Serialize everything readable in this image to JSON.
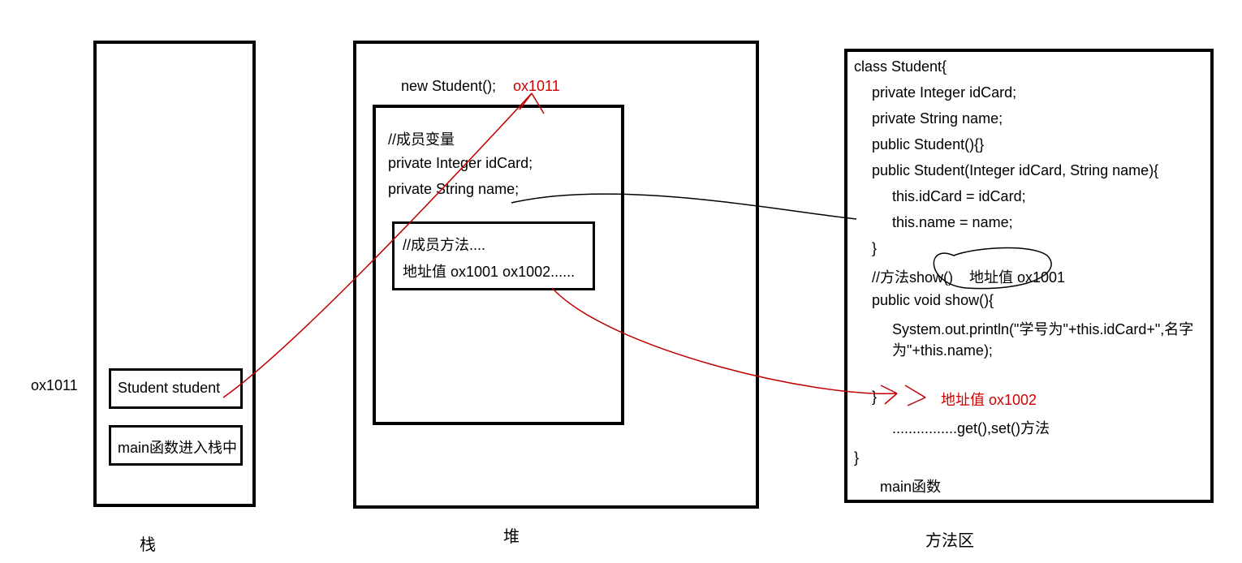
{
  "labels": {
    "stack": "栈",
    "heap": "堆",
    "methodArea": "方法区",
    "addrSide": "ox1011"
  },
  "stack": {
    "studentVar": "Student student",
    "mainFrame": "main函数进入栈中"
  },
  "heap": {
    "newStudent": "new Student();",
    "addr": "ox1011",
    "commentFields": "//成员变量",
    "field1": "private Integer idCard;",
    "field2": "private String name;",
    "commentMethods": "//成员方法....",
    "addrLine": "地址值 ox1001  ox1002......"
  },
  "methodArea": {
    "line1": "class Student{",
    "line2": "private Integer idCard;",
    "line3": "private String  name;",
    "line4": "public Student(){}",
    "line5": "public Student(Integer idCard, String name){",
    "line6": "this.idCard = idCard;",
    "line7": "this.name = name;",
    "line8": "}",
    "line9": "//方法show()",
    "addr1": "地址值 ox1001",
    "line10": "public void show(){",
    "line11": "System.out.println(\"学号为\"+this.idCard+\",名字为\"+this.name);",
    "line12": "}",
    "addr2": "地址值 ox1002",
    "line13": "................get(),set()方法",
    "line14": "}",
    "line15": "main函数"
  }
}
